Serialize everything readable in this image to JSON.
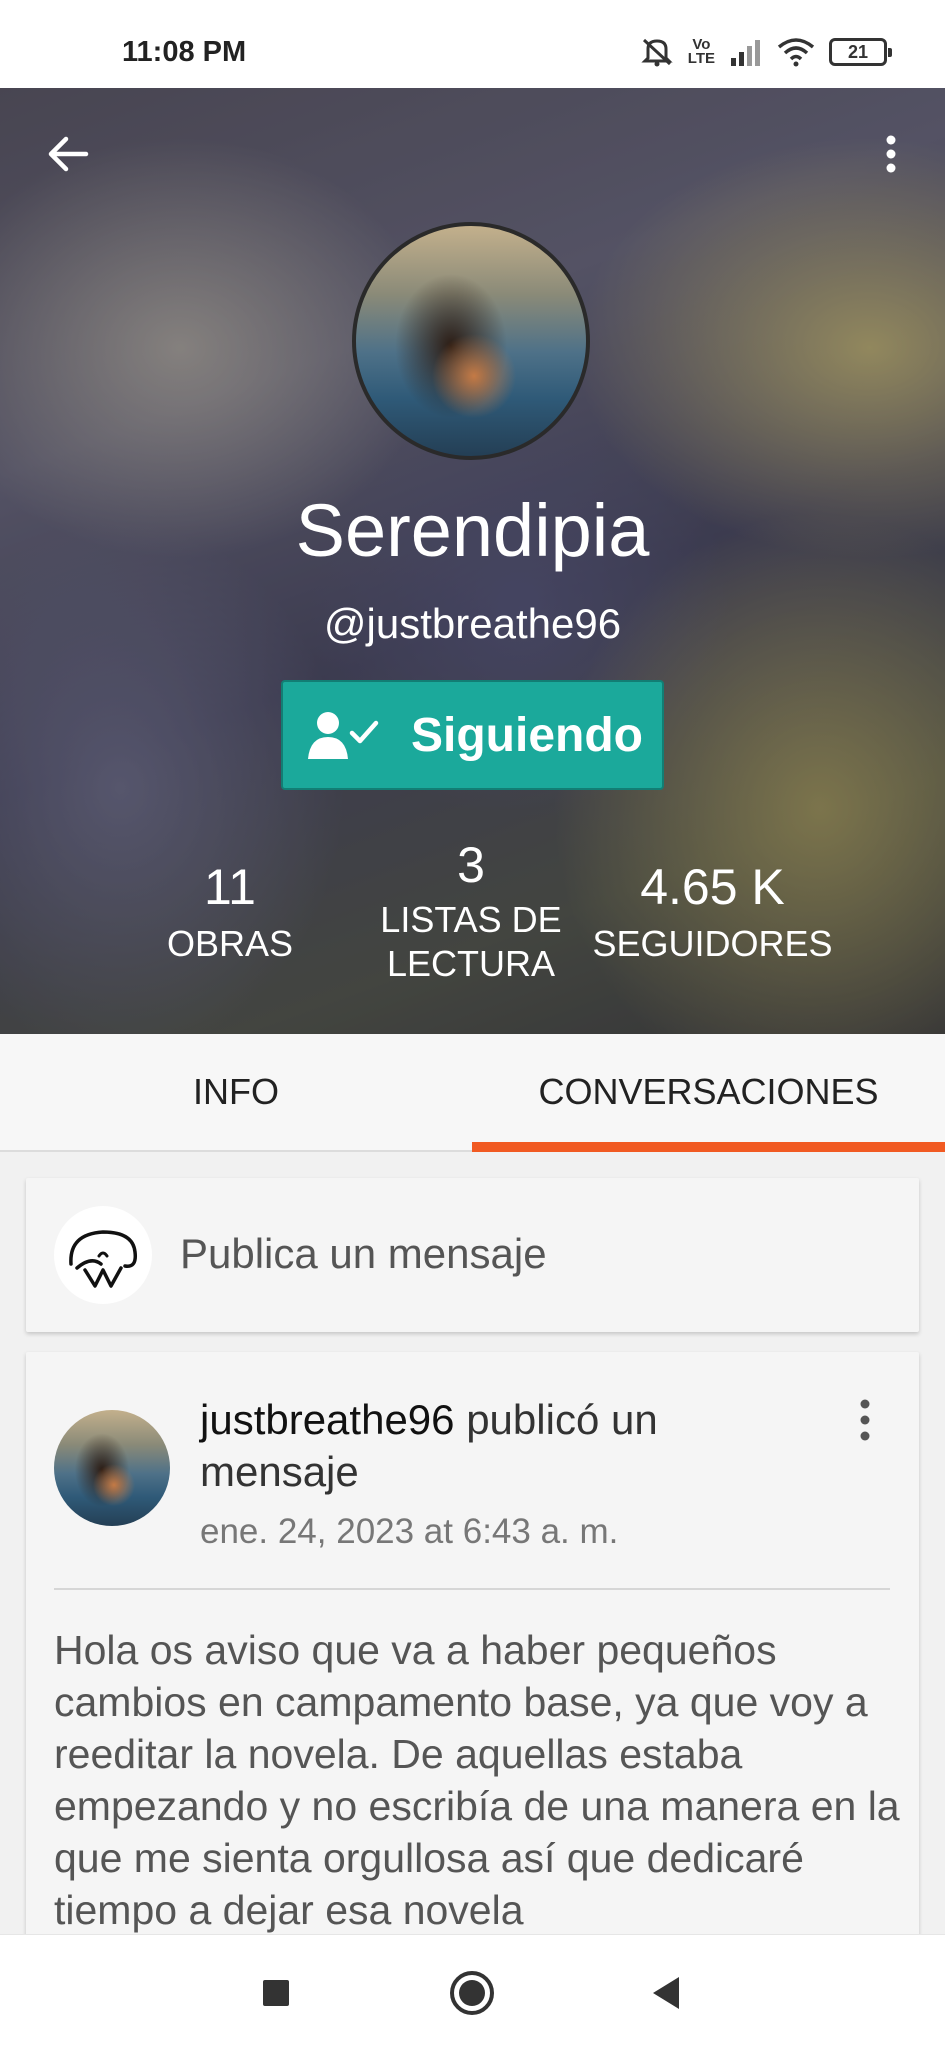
{
  "status_bar": {
    "time": "11:08 PM",
    "battery": "21",
    "volte": "Vo\nLTE",
    "icons": [
      "mute-icon",
      "volte-icon",
      "signal-icon",
      "wifi-icon",
      "battery-icon"
    ]
  },
  "header": {
    "back_icon": "arrow-left-icon",
    "more_icon": "more-vertical-icon",
    "display_name": "Serendipia",
    "username": "@justbreathe96",
    "follow_label": "Siguiendo",
    "follow_icon": "user-check-icon",
    "button_color": "#1ba99b",
    "stats": {
      "works": {
        "value": "11",
        "label": "OBRAS"
      },
      "reading_lists": {
        "value": "3",
        "label_line1": "LISTAS DE",
        "label_line2": "LECTURA"
      },
      "followers": {
        "value": "4.65 K",
        "label": "SEGUIDORES"
      }
    }
  },
  "tabs": {
    "info": "INFO",
    "conversations": "CONVERSACIONES",
    "active": "conversations",
    "accent": "#f15a22"
  },
  "compose": {
    "placeholder": "Publica un mensaje"
  },
  "message": {
    "author": "justbreathe96",
    "action": " publicó un mensaje",
    "date": "ene. 24, 2023 at 6:43 a. m.",
    "body": "Hola os aviso que va a haber pequeños cambios en campamento base, ya que voy a reeditar la novela. De aquellas estaba empezando y no escribía de una manera en la que me sienta orgullosa así que dedicaré tiempo a dejar esa novela"
  },
  "nav_bar": {
    "icons": [
      "recents-square-icon",
      "home-circle-icon",
      "back-triangle-icon"
    ]
  }
}
